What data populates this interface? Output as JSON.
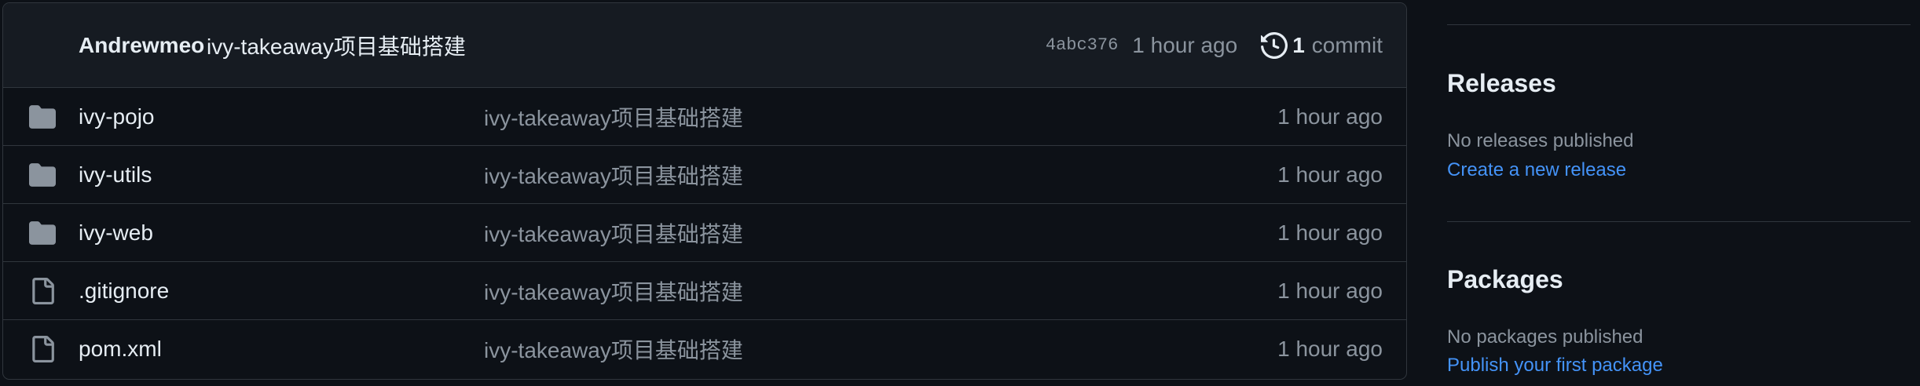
{
  "latest_commit": {
    "author": "Andrewmeo",
    "message": "ivy-takeaway项目基础搭建",
    "sha": "4abc376",
    "time": "1 hour ago",
    "count": "1",
    "count_label": "commit"
  },
  "files": [
    {
      "type": "folder",
      "name": "ivy-pojo",
      "message": "ivy-takeaway项目基础搭建",
      "time": "1 hour ago"
    },
    {
      "type": "folder",
      "name": "ivy-utils",
      "message": "ivy-takeaway项目基础搭建",
      "time": "1 hour ago"
    },
    {
      "type": "folder",
      "name": "ivy-web",
      "message": "ivy-takeaway项目基础搭建",
      "time": "1 hour ago"
    },
    {
      "type": "file",
      "name": ".gitignore",
      "message": "ivy-takeaway项目基础搭建",
      "time": "1 hour ago"
    },
    {
      "type": "file",
      "name": "pom.xml",
      "message": "ivy-takeaway项目基础搭建",
      "time": "1 hour ago"
    }
  ],
  "sidebar": {
    "releases": {
      "title": "Releases",
      "empty_text": "No releases published",
      "link": "Create a new release"
    },
    "packages": {
      "title": "Packages",
      "empty_text": "No packages published",
      "link": "Publish your first package"
    }
  },
  "colors": {
    "background": "#0d1117",
    "header_bg": "#161b22",
    "border": "#30363d",
    "text": "#e6edf3",
    "muted": "#8b949e",
    "link": "#4493f8",
    "icon": "#8b949e"
  }
}
